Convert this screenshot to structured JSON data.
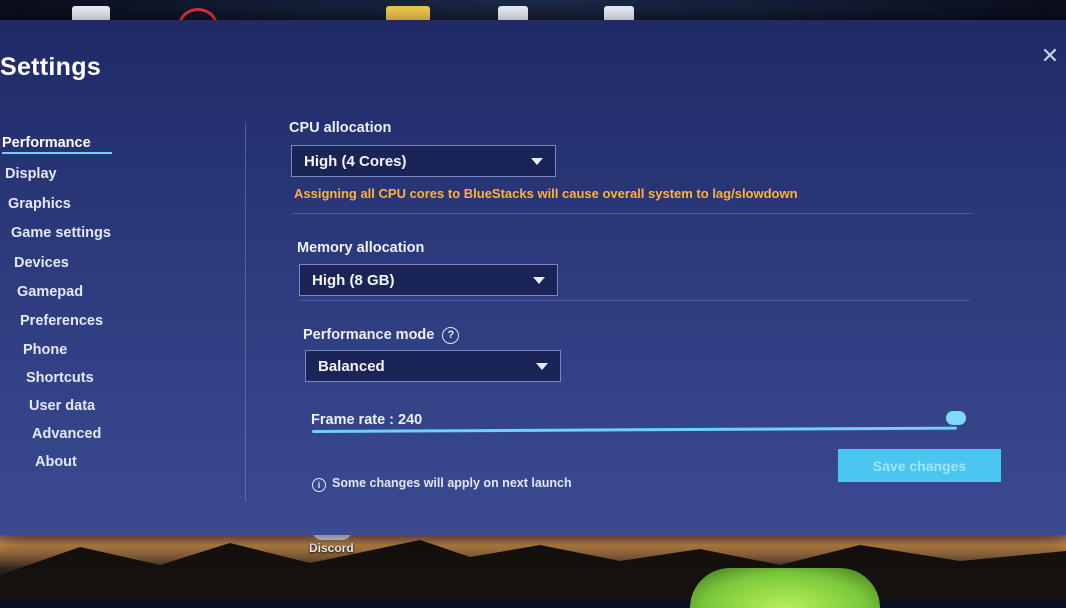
{
  "window": {
    "title": "Settings",
    "close_glyph": "✕"
  },
  "sidebar": {
    "items": [
      {
        "label": "Performance",
        "active": true
      },
      {
        "label": "Display"
      },
      {
        "label": "Graphics"
      },
      {
        "label": "Game settings"
      },
      {
        "label": "Devices"
      },
      {
        "label": "Gamepad"
      },
      {
        "label": "Preferences"
      },
      {
        "label": "Phone"
      },
      {
        "label": "Shortcuts"
      },
      {
        "label": "User data"
      },
      {
        "label": "Advanced"
      },
      {
        "label": "About"
      }
    ]
  },
  "performance": {
    "cpu": {
      "label": "CPU allocation",
      "value": "High (4 Cores)",
      "warning": "Assigning all CPU cores to BlueStacks will cause overall system to lag/slowdown"
    },
    "memory": {
      "label": "Memory allocation",
      "value": "High (8 GB)"
    },
    "mode": {
      "label": "Performance mode",
      "help_glyph": "?",
      "value": "Balanced"
    },
    "frame_rate": {
      "label": "Frame rate : 240",
      "value": 240,
      "slider_fraction": 1.0
    },
    "footnote": {
      "info_glyph": "i",
      "text": "Some changes will apply on next launch"
    },
    "save_label": "Save changes"
  },
  "desktop": {
    "discord_label": "Discord"
  },
  "colors": {
    "accent": "#4ac6f0",
    "warning": "#ffb13a",
    "panel": "#2c3a7c"
  }
}
